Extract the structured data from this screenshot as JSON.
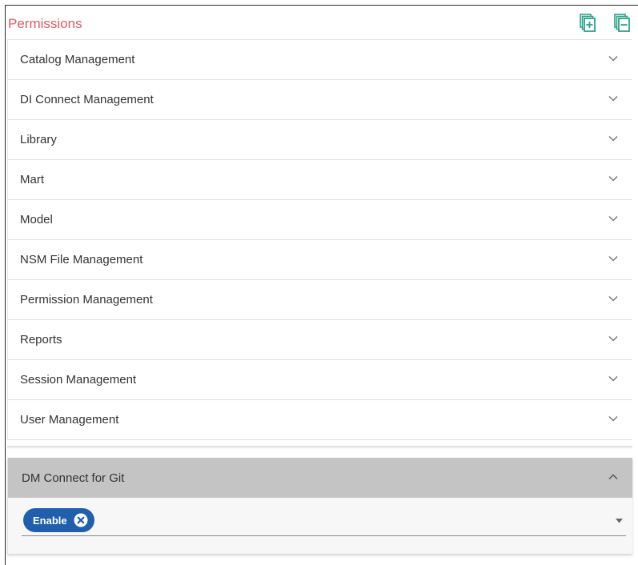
{
  "header": {
    "title": "Permissions",
    "expand_all_icon": "expand-all-icon",
    "collapse_all_icon": "collapse-all-icon"
  },
  "colors": {
    "title": "#e05a63",
    "header_icons": "#2aa28c",
    "open_header_bg": "#c4c4c4",
    "chip_bg": "#1f5fae"
  },
  "sections": [
    {
      "label": "Catalog Management",
      "icon": "chevron-down-icon"
    },
    {
      "label": "DI Connect Management",
      "icon": "chevron-down-icon"
    },
    {
      "label": "Library",
      "icon": "chevron-down-icon"
    },
    {
      "label": "Mart",
      "icon": "chevron-down-icon"
    },
    {
      "label": "Model",
      "icon": "chevron-down-icon"
    },
    {
      "label": "NSM File Management",
      "icon": "chevron-down-icon"
    },
    {
      "label": "Permission Management",
      "icon": "chevron-down-icon"
    },
    {
      "label": "Reports",
      "icon": "chevron-down-icon"
    },
    {
      "label": "Session Management",
      "icon": "chevron-down-icon"
    },
    {
      "label": "User Management",
      "icon": "chevron-down-icon"
    }
  ],
  "open_section": {
    "label": "DM Connect for Git",
    "icon": "chevron-up-icon",
    "selected_chips": [
      "Enable"
    ]
  }
}
